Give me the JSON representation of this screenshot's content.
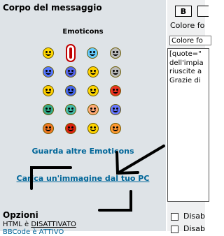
{
  "header": {
    "title": "Corpo del messaggio"
  },
  "emoticons": {
    "title": "Emoticons",
    "rows": [
      [
        {
          "name": "smile",
          "color": "#ffd700"
        },
        {
          "name": "tall-face",
          "color": "#ffffff",
          "special": "big"
        },
        {
          "name": "cool-face",
          "color": "#66ccff"
        },
        {
          "name": "neutral-face",
          "color": "#bdbdbd"
        }
      ],
      [
        {
          "name": "sad-face",
          "color": "#5577ff"
        },
        {
          "name": "surprised-face",
          "color": "#5566ee"
        },
        {
          "name": "shocked-face",
          "color": "#ffd200"
        },
        {
          "name": "cool-glasses-face",
          "color": "#bbbbbb"
        }
      ],
      [
        {
          "name": "confused-face",
          "color": "#ffd000"
        },
        {
          "name": "blue-face",
          "color": "#4466ee"
        },
        {
          "name": "smirk-face",
          "color": "#ffd700"
        },
        {
          "name": "angry-face",
          "color": "#ee3322"
        }
      ],
      [
        {
          "name": "green-face",
          "color": "#33aa88"
        },
        {
          "name": "teal-face",
          "color": "#44bbaa"
        },
        {
          "name": "blush-face",
          "color": "#ffaa77"
        },
        {
          "name": "crying-face",
          "color": "#6677ff"
        }
      ],
      [
        {
          "name": "devil-face",
          "color": "#ee7722"
        },
        {
          "name": "red-devil-face",
          "color": "#dd2211"
        },
        {
          "name": "wink-face",
          "color": "#ffd400"
        },
        {
          "name": "orange-face",
          "color": "#ff9933"
        }
      ]
    ]
  },
  "links": {
    "more_emoticons": "Guarda altre Emoticons",
    "upload_image": "Carica un'immagine dal tuo PC"
  },
  "options": {
    "title": "Opzioni",
    "html_label": "HTML è ",
    "html_value": "DISATTIVATO",
    "bbcode_label": "BBCode è ATTIVO"
  },
  "toolbar": {
    "bold_label": "B",
    "color_label": "Colore fo"
  },
  "color_select": {
    "value": "Colore fo"
  },
  "message": {
    "text": "[quote=\"\ndell'impia\nriuscite a\nGrazie di"
  },
  "right_options": {
    "item1": "Disab",
    "item2": "Disab"
  },
  "colors": {
    "panel": "#dee3e7",
    "accent_link": "#006699"
  }
}
